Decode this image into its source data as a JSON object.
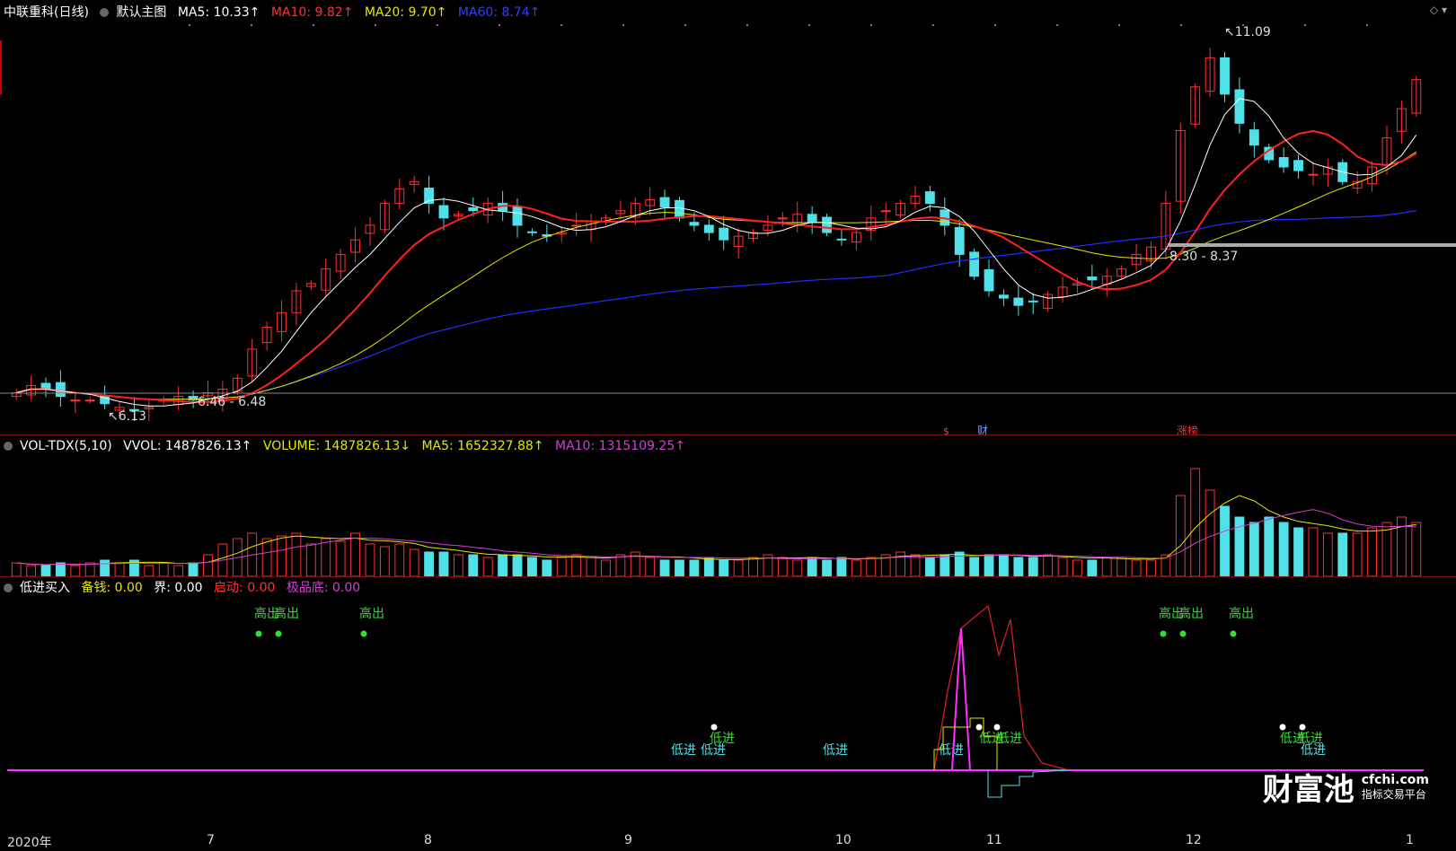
{
  "main": {
    "stock_title": "中联重科(日线)",
    "chart_name": "默认主图",
    "ma5": "MA5: 10.33↑",
    "ma10": "MA10: 9.82↑",
    "ma20": "MA20: 9.70↑",
    "ma60": "MA60: 8.74↑",
    "colors": {
      "ma5": "#ffffff",
      "ma10": "#ff2020",
      "ma20": "#e6e600",
      "ma60": "#2030ff",
      "up": "#ff3030",
      "down": "#50e0e8"
    }
  },
  "volume": {
    "title": "VOL-TDX(5,10)",
    "vvol": "VVOL: 1487826.13↑",
    "volume": "VOLUME: 1487826.13↓",
    "ma5": "MA5: 1652327.88↑",
    "ma10": "MA10: 1315109.25↑"
  },
  "indicator": {
    "name": "低进买入",
    "beiqian": "备钱: 0.00",
    "jie": "界: 0.00",
    "qidong": "启动: 0.00",
    "jipindi": "极品底: 0.00",
    "labels_high": [
      "高出",
      "高出",
      "高出",
      "高出",
      "高出",
      "高出"
    ],
    "labels_low": [
      "低进",
      "低进",
      "低进",
      "低进",
      "低进",
      "低进",
      "低进",
      "低进",
      "低进",
      "低进"
    ]
  },
  "annotations": {
    "high_label": "11.09",
    "low_label": "6.13",
    "range_label_1": "6.46 - 6.48",
    "range_label_2": "8.30 - 8.37",
    "marker_s": "$",
    "marker_cai": "财",
    "marker_zhang": "涨榜"
  },
  "date_axis": [
    "2020年",
    "7",
    "8",
    "9",
    "10",
    "11",
    "12",
    "1"
  ],
  "logo": {
    "brand": "财富池",
    "domain": "cfchi.com",
    "slogan": "指标交易平台"
  },
  "chart_data": {
    "type": "candlestick",
    "ylim": [
      6.0,
      11.3
    ],
    "close_path": [
      6.4,
      6.5,
      6.45,
      6.35,
      6.3,
      6.3,
      6.25,
      6.2,
      6.15,
      6.2,
      6.3,
      6.35,
      6.3,
      6.4,
      6.45,
      6.6,
      7.0,
      7.3,
      7.5,
      7.8,
      7.9,
      8.1,
      8.3,
      8.5,
      8.7,
      9.0,
      9.2,
      9.3,
      9.0,
      8.8,
      8.85,
      8.9,
      9.0,
      8.9,
      8.7,
      8.6,
      8.55,
      8.6,
      8.7,
      8.75,
      8.8,
      8.9,
      9.0,
      9.05,
      8.95,
      8.8,
      8.7,
      8.6,
      8.5,
      8.55,
      8.6,
      8.7,
      8.8,
      8.85,
      8.75,
      8.6,
      8.5,
      8.6,
      8.8,
      8.9,
      9.0,
      9.1,
      9.0,
      8.7,
      8.3,
      8.0,
      7.8,
      7.7,
      7.6,
      7.65,
      7.75,
      7.85,
      7.9,
      7.95,
      8.0,
      8.1,
      8.3,
      8.4,
      9.0,
      10.0,
      10.6,
      11.0,
      10.5,
      10.1,
      9.8,
      9.6,
      9.5,
      9.45,
      9.4,
      9.5,
      9.3,
      9.3,
      9.5,
      9.9,
      10.3,
      10.7
    ],
    "volume_path": [
      0.25,
      0.2,
      0.2,
      0.25,
      0.2,
      0.25,
      0.3,
      0.25,
      0.3,
      0.2,
      0.25,
      0.2,
      0.25,
      0.4,
      0.6,
      0.7,
      0.8,
      0.7,
      0.75,
      0.8,
      0.6,
      0.7,
      0.65,
      0.8,
      0.6,
      0.55,
      0.6,
      0.5,
      0.45,
      0.45,
      0.4,
      0.4,
      0.35,
      0.4,
      0.4,
      0.35,
      0.3,
      0.35,
      0.4,
      0.35,
      0.3,
      0.4,
      0.45,
      0.35,
      0.3,
      0.3,
      0.3,
      0.35,
      0.3,
      0.3,
      0.35,
      0.4,
      0.35,
      0.3,
      0.35,
      0.3,
      0.35,
      0.3,
      0.35,
      0.4,
      0.45,
      0.4,
      0.35,
      0.4,
      0.45,
      0.35,
      0.4,
      0.4,
      0.35,
      0.35,
      0.4,
      0.35,
      0.3,
      0.3,
      0.35,
      0.35,
      0.3,
      0.3,
      0.4,
      1.5,
      2.0,
      1.6,
      1.3,
      1.1,
      1.0,
      1.1,
      1.0,
      0.9,
      0.9,
      0.8,
      0.8,
      0.8,
      0.9,
      1.0,
      1.1,
      1.0
    ]
  }
}
